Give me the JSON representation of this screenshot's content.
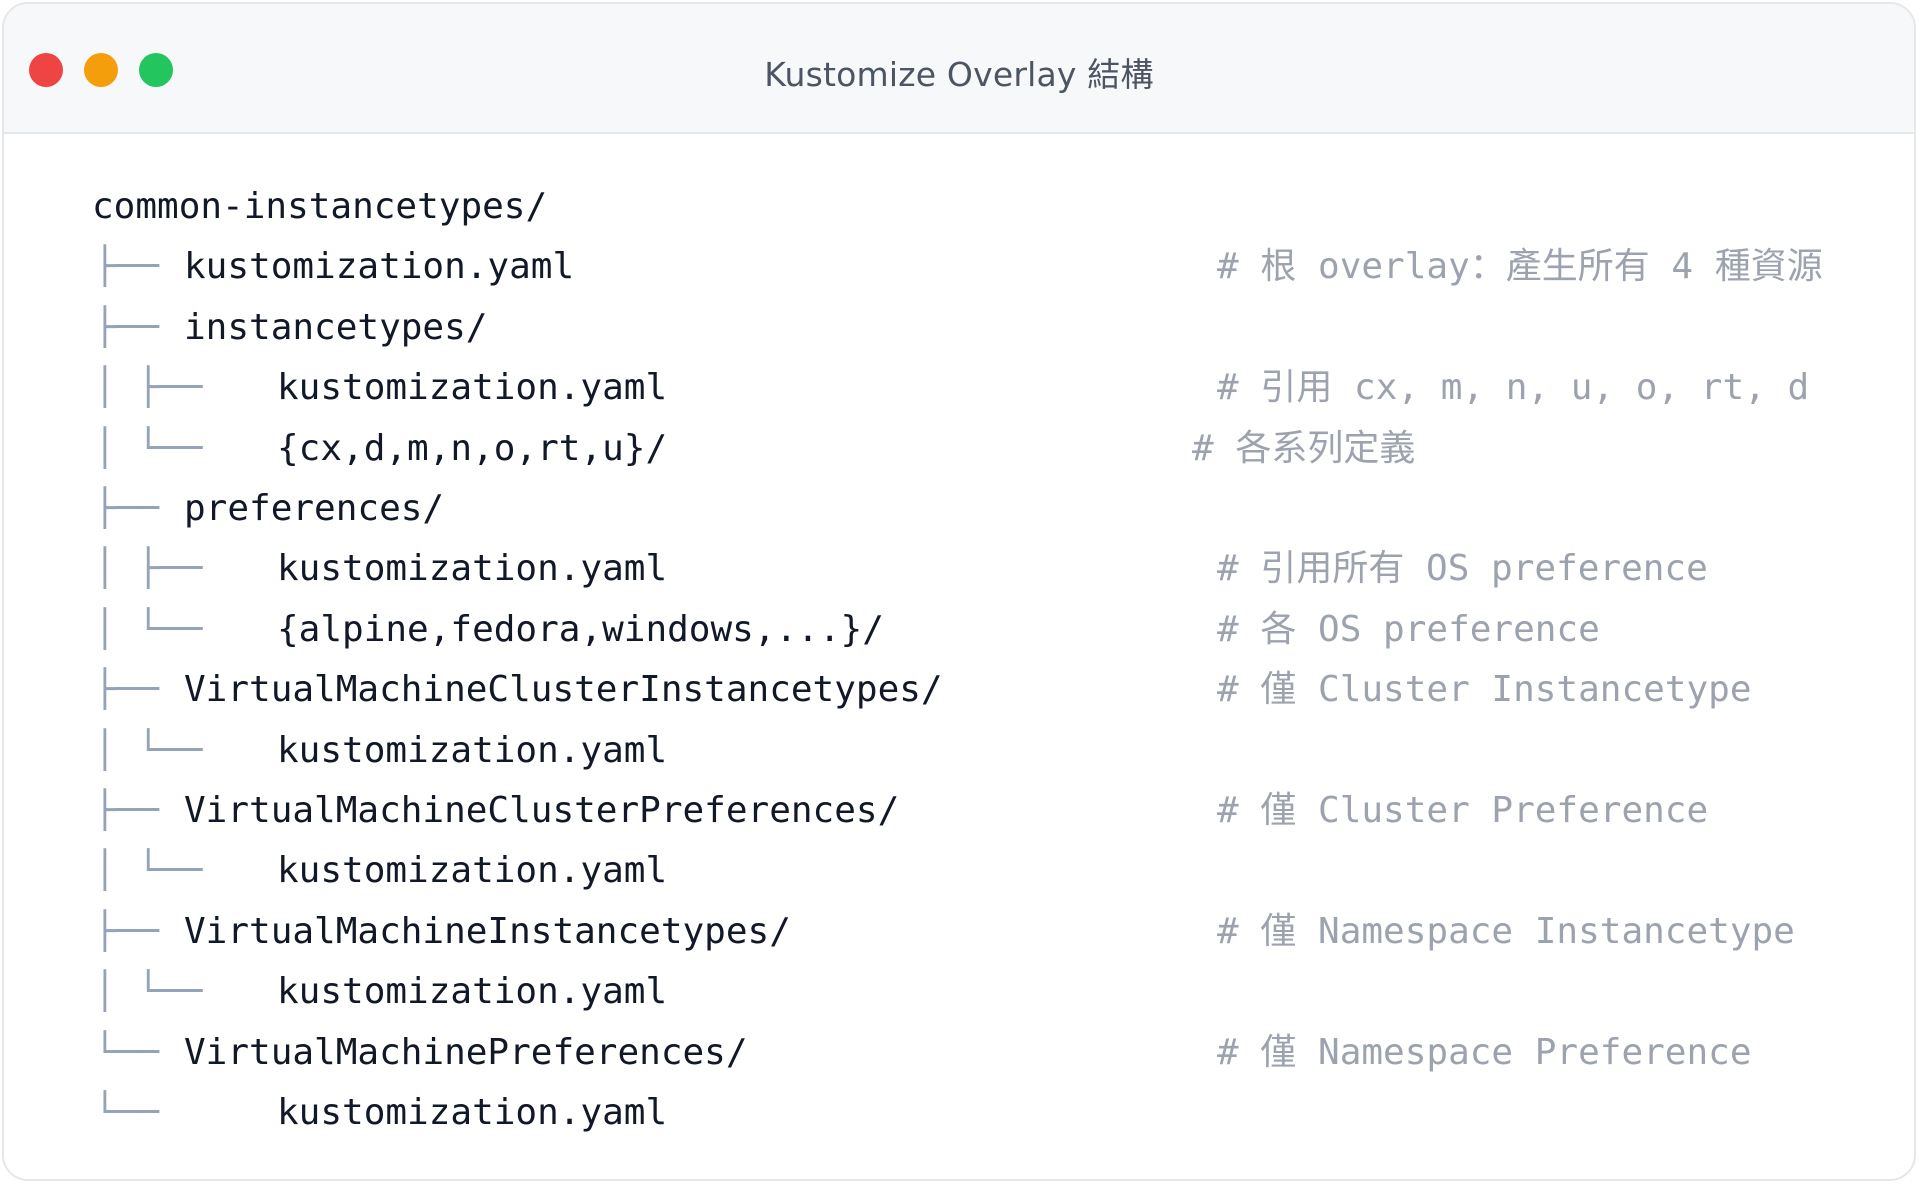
{
  "window": {
    "title": "Kustomize Overlay 結構"
  },
  "tree": [
    {
      "glyph": "",
      "name": "common-instancetypes/",
      "comment": "",
      "level": 0
    },
    {
      "glyph": "├──",
      "name": "kustomization.yaml",
      "comment": "# 根 overlay：產生所有 4 種資源",
      "level": 1
    },
    {
      "glyph": "├──",
      "name": "instancetypes/",
      "comment": "",
      "level": 1
    },
    {
      "glyph": "│ ├──",
      "name": "kustomization.yaml",
      "comment": "# 引用 cx, m, n, u, o, rt, d",
      "level": 2
    },
    {
      "glyph": "│ └──",
      "name": "{cx,d,m,n,o,rt,u}/",
      "comment": "# 各系列定義",
      "level": 2
    },
    {
      "glyph": "├──",
      "name": "preferences/",
      "comment": "",
      "level": 1
    },
    {
      "glyph": "│ ├──",
      "name": "kustomization.yaml",
      "comment": "# 引用所有 OS preference",
      "level": 2
    },
    {
      "glyph": "│ └──",
      "name": "{alpine,fedora,windows,...}/",
      "comment": "# 各 OS preference",
      "level": 2
    },
    {
      "glyph": "├──",
      "name": "VirtualMachineClusterInstancetypes/",
      "comment": "# 僅 Cluster Instancetype",
      "level": 1
    },
    {
      "glyph": "│ └──",
      "name": "kustomization.yaml",
      "comment": "",
      "level": 2
    },
    {
      "glyph": "├──",
      "name": "VirtualMachineClusterPreferences/",
      "comment": "# 僅 Cluster Preference",
      "level": 1
    },
    {
      "glyph": "│ └──",
      "name": "kustomization.yaml",
      "comment": "",
      "level": 2
    },
    {
      "glyph": "├──",
      "name": "VirtualMachineInstancetypes/",
      "comment": "# 僅 Namespace Instancetype",
      "level": 1
    },
    {
      "glyph": "│ └──",
      "name": "kustomization.yaml",
      "comment": "",
      "level": 2
    },
    {
      "glyph": "└──",
      "name": "VirtualMachinePreferences/",
      "comment": "# 僅 Namespace Preference",
      "level": 1
    },
    {
      "glyph": "└──",
      "name": "kustomization.yaml",
      "comment": "",
      "level": 2
    }
  ]
}
